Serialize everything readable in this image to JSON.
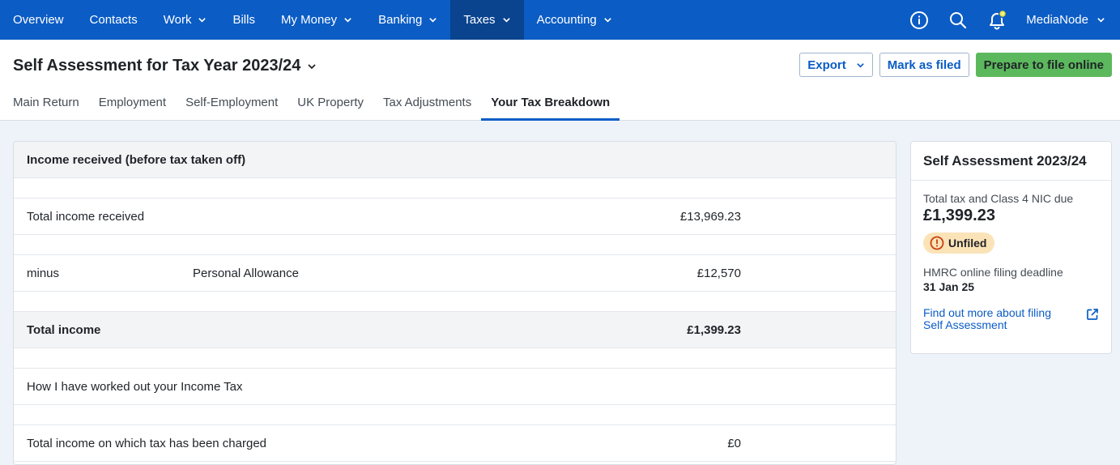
{
  "nav": {
    "items": [
      {
        "label": "Overview"
      },
      {
        "label": "Contacts"
      },
      {
        "label": "Work"
      },
      {
        "label": "Bills"
      },
      {
        "label": "My Money"
      },
      {
        "label": "Banking"
      },
      {
        "label": "Taxes"
      },
      {
        "label": "Accounting"
      }
    ],
    "user_name": "MediaNode",
    "icons": [
      "info-icon",
      "search-icon",
      "bell-icon"
    ]
  },
  "header": {
    "title": "Self Assessment for Tax Year 2023/24",
    "export_label": "Export",
    "mark_filed_label": "Mark as filed",
    "prepare_label": "Prepare to file online"
  },
  "tabs": [
    {
      "label": "Main Return"
    },
    {
      "label": "Employment"
    },
    {
      "label": "Self-Employment"
    },
    {
      "label": "UK Property"
    },
    {
      "label": "Tax Adjustments"
    },
    {
      "label": "Your Tax Breakdown"
    }
  ],
  "breakdown": {
    "heading": "Income received (before tax taken off)",
    "rows": {
      "total_income_received": {
        "label": "Total income received",
        "amount": "£13,969.23"
      },
      "personal_allowance": {
        "prefix": "minus",
        "label": "Personal Allowance",
        "amount": "£12,570"
      },
      "total_income": {
        "label": "Total income",
        "amount": "£1,399.23"
      },
      "worked_out": {
        "label": "How I have worked out your Income Tax"
      },
      "taxed_income": {
        "label": "Total income on which tax has been charged",
        "amount": "£0"
      }
    }
  },
  "summary": {
    "title": "Self Assessment 2023/24",
    "due_label": "Total tax and Class 4 NIC due",
    "due_amount": "£1,399.23",
    "status": "Unfiled",
    "deadline_label": "HMRC online filing deadline",
    "deadline_value": "31 Jan 25",
    "link_label": "Find out more about filing Self Assessment"
  },
  "colors": {
    "nav_bg": "#0b5cc5",
    "nav_active": "#0a448f",
    "primary_button": "#5cb85c",
    "status_badge": "#fbe3b8",
    "link": "#0b5cc5"
  }
}
